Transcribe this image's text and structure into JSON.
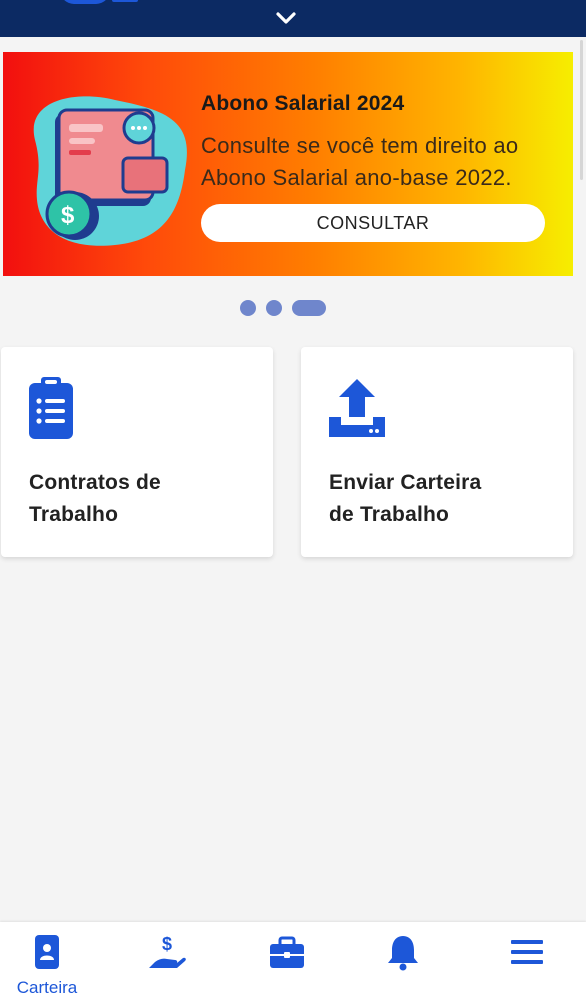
{
  "colors": {
    "primary_blue": "#1d57d8",
    "topbar": "#0c2a63",
    "banner_gradient_start": "#f20f0f",
    "banner_gradient_end": "#f6ee00",
    "dot": "#6f86cc",
    "background": "#f4f4f4"
  },
  "banner": {
    "title": "Abono Salarial 2024",
    "subtitle": "Consulte se você tem direito ao Abono Salarial ano-base 2022.",
    "button_label": "CONSULTAR",
    "illustration_icon": "wallet-with-coin-icon"
  },
  "carousel": {
    "total_slides": 3,
    "active_slide": 3
  },
  "cards": [
    {
      "label_line1": "Contratos de",
      "label_line2": "Trabalho",
      "icon": "clipboard-list-icon"
    },
    {
      "label_line1": "Enviar Carteira",
      "label_line2": "de Trabalho",
      "icon": "upload-tray-icon"
    }
  ],
  "bottom_nav": {
    "items": [
      {
        "label": "Carteira",
        "icon": "id-card-icon",
        "active": true
      },
      {
        "label": "",
        "icon": "hand-dollar-icon",
        "active": false
      },
      {
        "label": "",
        "icon": "briefcase-icon",
        "active": false
      },
      {
        "label": "",
        "icon": "bell-icon",
        "active": false
      },
      {
        "label": "",
        "icon": "menu-icon",
        "active": false
      }
    ]
  }
}
